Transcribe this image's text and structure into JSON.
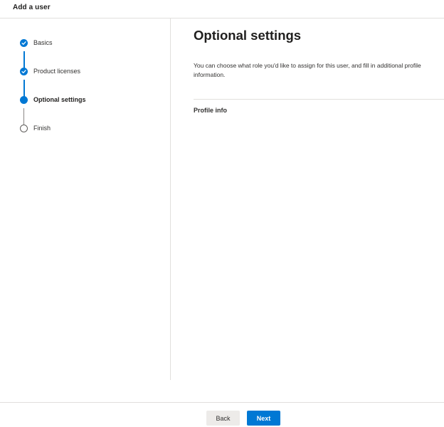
{
  "header": {
    "title": "Add a user"
  },
  "steps": [
    {
      "label": "Basics",
      "state": "done"
    },
    {
      "label": "Product licenses",
      "state": "done"
    },
    {
      "label": "Optional settings",
      "state": "current"
    },
    {
      "label": "Finish",
      "state": "pending"
    }
  ],
  "main": {
    "title": "Optional settings",
    "description": "You can choose what role you'd like to assign for this user, and fill in additional profile information.",
    "sections": [
      {
        "label": "Profile info"
      }
    ]
  },
  "footer": {
    "back_label": "Back",
    "next_label": "Next"
  },
  "colors": {
    "accent": "#0078d4",
    "border": "#e1dfdd",
    "secondary_button": "#edebe9"
  },
  "icons": {
    "step_done": "checkmark-icon",
    "step_current": "filled-circle-icon",
    "step_pending": "empty-circle-icon"
  }
}
